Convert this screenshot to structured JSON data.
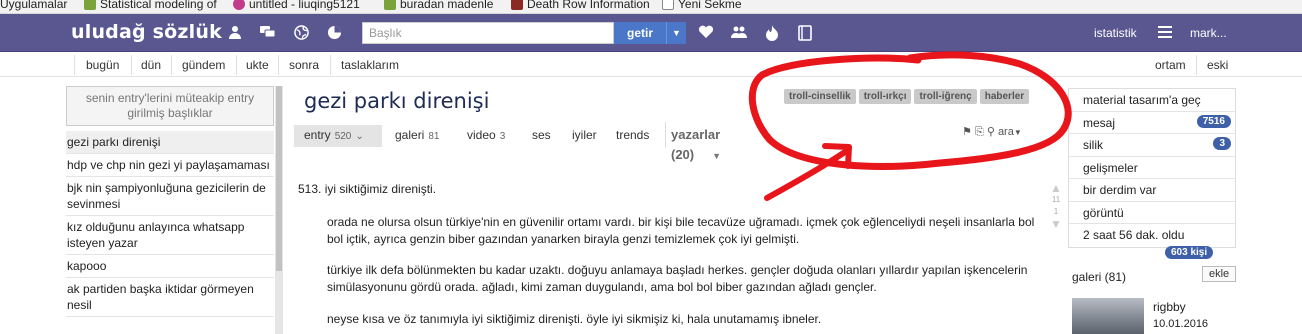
{
  "bookmarks": [
    {
      "label": "Uygulamalar",
      "color": "#4a77c7"
    },
    {
      "label": "Statistical modeling of",
      "color": "#7aa33a"
    },
    {
      "label": "untitled - liuqing5121",
      "color": "#c23a8a"
    },
    {
      "label": "buradan madenle",
      "color": "#7aa33a"
    },
    {
      "label": "Death Row Information",
      "color": "#8a2a22"
    },
    {
      "label": "Yeni Sekme",
      "color": "#ffffff"
    }
  ],
  "header": {
    "logo": "uludağ sözlük",
    "search_placeholder": "Başlık",
    "search_button": "getir",
    "stats_link": "istatistik",
    "user": "mark...",
    "bg_color": "#5a5690"
  },
  "subnav": {
    "left": [
      "bugün",
      "dün",
      "gündem",
      "ukte",
      "sonra",
      "taslaklarım"
    ],
    "right": [
      "ortam",
      "eski"
    ]
  },
  "left": {
    "notice": "senin entry'lerini müteakip entry girilmiş başlıklar",
    "items": [
      "gezi parkı direnişi",
      "hdp ve chp nin gezi yi paylaşamaması",
      "bjk nin şampiyonluğuna gezicilerin de sevinmesi",
      "kız olduğunu anlayınca whatsapp isteyen yazar",
      "kapooo",
      "ak partiden başka iktidar görmeyen nesil"
    ]
  },
  "main": {
    "title": "gezi parkı direnişi",
    "tags": [
      "troll-cinsellik",
      "troll-ırkçı",
      "troll-iğrenç",
      "haberler"
    ],
    "tabs": [
      {
        "label": "entry",
        "count": "520"
      },
      {
        "label": "galeri",
        "count": "81"
      },
      {
        "label": "video",
        "count": "3"
      },
      {
        "label": "ses",
        "count": ""
      },
      {
        "label": "iyiler",
        "count": ""
      },
      {
        "label": "trends",
        "count": ""
      }
    ],
    "yazarlar": "yazarlar (20)",
    "tools": "ara",
    "entry_number": "513.",
    "entry_lead": "iyi siktiğimiz direnişti.",
    "paragraphs": [
      "orada ne olursa olsun türkiye'nin en güvenilir ortamı vardı. bir kişi bile tecavüze uğramadı. içmek çok eğlenceliydi neşeli insanlarla bol bol içtik, ayrıca genzin biber gazından yanarken birayla genzi temizlemek çok iyi gelmişti.",
      "türkiye ilk defa bölünmekten bu kadar uzaktı. doğuyu anlamaya başladı herkes. gençler doğuda olanları yıllardır yapılan işkencelerin simülasyonunu gördü orada. ağladı, kimi zaman duygulandı, ama bol bol biber gazından ağladı gençler.",
      "neyse kısa ve öz tanımıyla iyi siktiğimiz direnişti. öyle iyi sikmişiz ki, hala unutamamış ibneler."
    ],
    "vote_up": "11",
    "vote_down": "1"
  },
  "right": {
    "items": [
      {
        "label": "material tasarım'a geç",
        "badge": ""
      },
      {
        "label": "mesaj",
        "badge": "7516"
      },
      {
        "label": "silik",
        "badge": "3"
      },
      {
        "label": "gelişmeler",
        "badge": ""
      },
      {
        "label": "bir derdim var",
        "badge": ""
      },
      {
        "label": "görüntü",
        "badge": ""
      },
      {
        "label": "2 saat 56 dak. oldu",
        "badge": ""
      }
    ],
    "online": "603 kişi",
    "galeri_title": "galeri (81)",
    "galeri_add": "ekle",
    "galeri_user": "rigbby",
    "galeri_date": "10.01.2016"
  },
  "colors": {
    "accent": "#4a77c7",
    "badge": "#3d60a8",
    "annotation": "#e8151b"
  }
}
